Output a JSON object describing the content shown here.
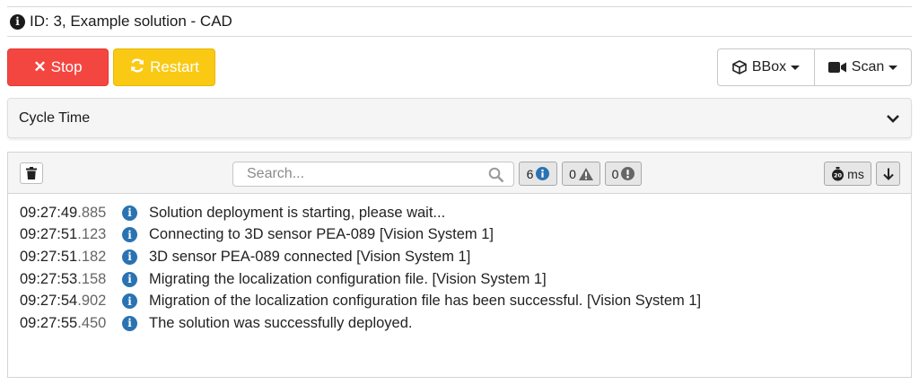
{
  "header": {
    "title": "ID: 3, Example solution - CAD",
    "icon": "info-circle-icon"
  },
  "controls": {
    "stop_label": "Stop",
    "restart_label": "Restart",
    "bbox_label": "BBox",
    "scan_label": "Scan",
    "stop_color": "#f44640",
    "restart_color": "#f9c914"
  },
  "cycle_panel": {
    "title": "Cycle Time",
    "state": "collapsed"
  },
  "log": {
    "search_placeholder": "Search...",
    "counts": {
      "info": "6",
      "warning": "0",
      "error": "0"
    },
    "time_unit_label": "ms",
    "entries": [
      {
        "time": "09:27:49",
        "ms": ".885",
        "level": "info",
        "message": "Solution deployment is starting, please wait..."
      },
      {
        "time": "09:27:51",
        "ms": ".123",
        "level": "info",
        "message": "Connecting to 3D sensor PEA-089 [Vision System 1]"
      },
      {
        "time": "09:27:51",
        "ms": ".182",
        "level": "info",
        "message": "3D sensor PEA-089 connected [Vision System 1]"
      },
      {
        "time": "09:27:53",
        "ms": ".158",
        "level": "info",
        "message": "Migrating the localization configuration file. [Vision System 1]"
      },
      {
        "time": "09:27:54",
        "ms": ".902",
        "level": "info",
        "message": "Migration of the localization configuration file has been successful. [Vision System 1]"
      },
      {
        "time": "09:27:55",
        "ms": ".450",
        "level": "info",
        "message": "The solution was successfully deployed."
      }
    ]
  }
}
